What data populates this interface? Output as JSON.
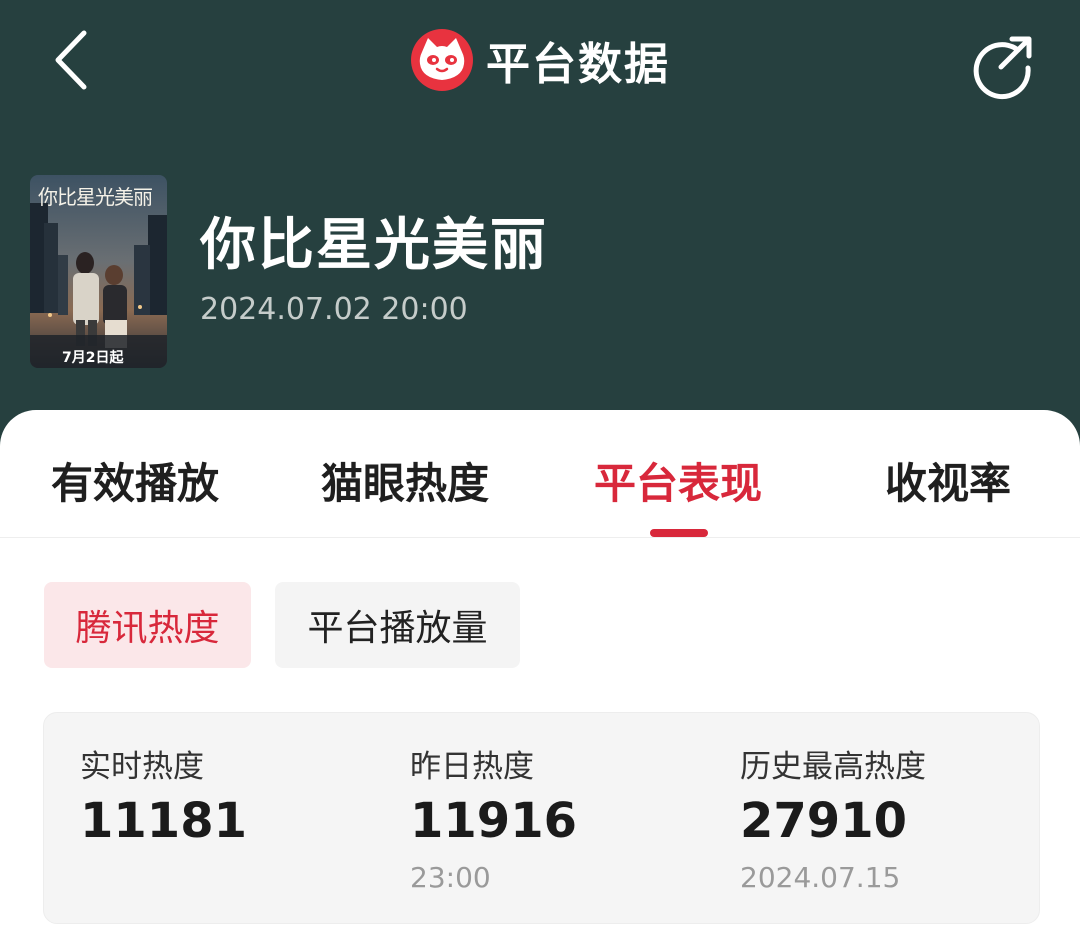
{
  "nav": {
    "title": "平台数据",
    "back_icon": "chevron-left-icon",
    "share_icon": "share-icon",
    "logo_icon": "cat-logo-icon"
  },
  "drama": {
    "poster_title": "你比星光美丽",
    "poster_date": "7月2日起",
    "title": "你比星光美丽",
    "air_time": "2024.07.02 20:00"
  },
  "tabs": [
    {
      "label": "有效播放",
      "active": false
    },
    {
      "label": "猫眼热度",
      "active": false
    },
    {
      "label": "平台表现",
      "active": true
    },
    {
      "label": "收视率",
      "active": false
    }
  ],
  "sub_tabs": [
    {
      "label": "腾讯热度",
      "active": true
    },
    {
      "label": "平台播放量",
      "active": false
    }
  ],
  "stats": [
    {
      "label": "实时热度",
      "value": "11181",
      "sub": ""
    },
    {
      "label": "昨日热度",
      "value": "11916",
      "sub": "23:00"
    },
    {
      "label": "历史最高热度",
      "value": "27910",
      "sub": "2024.07.15"
    }
  ],
  "colors": {
    "header_bg": "#26403f",
    "accent": "#d8283b",
    "active_chip_bg": "#fbe7e9",
    "stats_bg": "#f5f5f5"
  }
}
